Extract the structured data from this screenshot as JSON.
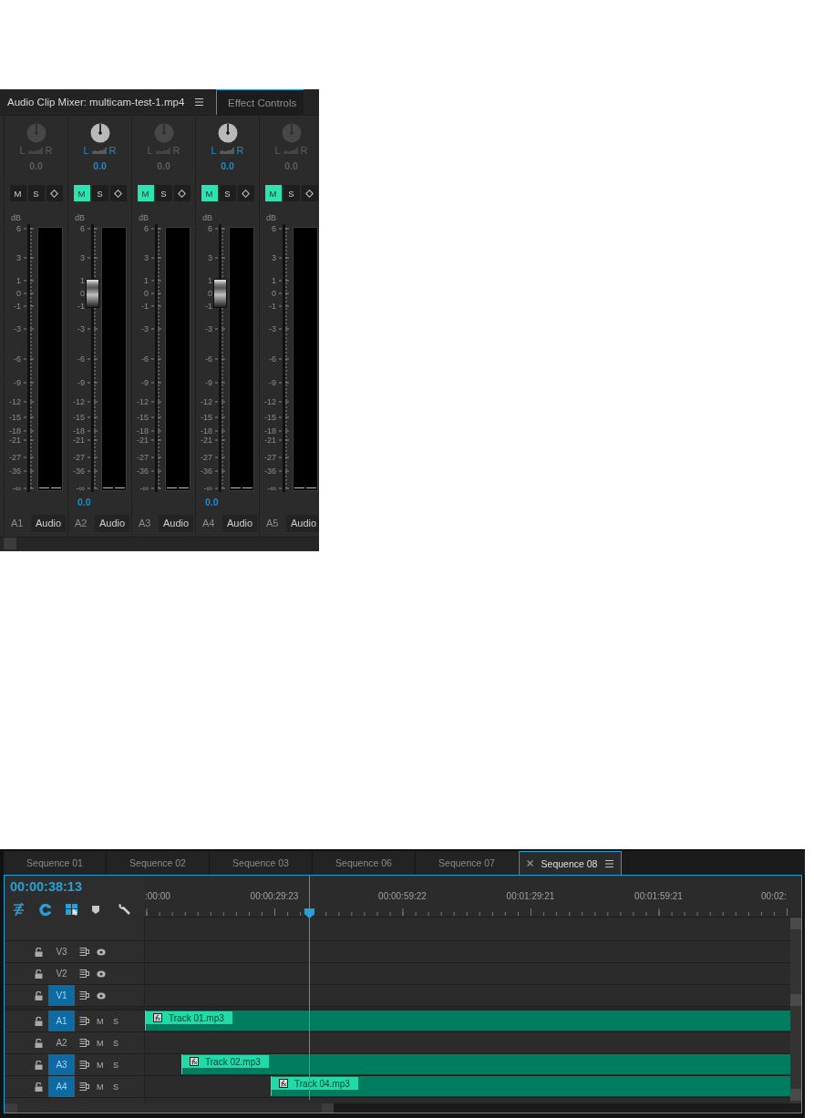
{
  "mixer": {
    "tabs": [
      {
        "label": "Audio Clip Mixer: multicam-test-1.mp4",
        "selected": true,
        "menu": true
      },
      {
        "label": "Effect Controls",
        "selected": false,
        "menu": false
      }
    ],
    "channels": [
      {
        "pan_left": "L",
        "pan_right": "R",
        "pan_value": "0.0",
        "active": false,
        "mute": "M",
        "solo": "S",
        "muted": false,
        "soloed": false,
        "unit": "dB",
        "scale": [
          "6",
          "3",
          "1",
          "0",
          "-1",
          "-3",
          "-6",
          "-9",
          "-12",
          "-15",
          "-18",
          "-21",
          "-27",
          "-36",
          "-∞"
        ],
        "label": "A1",
        "name": "Audio"
      },
      {
        "pan_left": "L",
        "pan_right": "R",
        "pan_value": "0.0",
        "active": true,
        "mute": "M",
        "solo": "S",
        "muted": true,
        "soloed": false,
        "unit": "dB",
        "scale": [
          "6",
          "3",
          "1",
          "0",
          "-1",
          "-3",
          "-6",
          "-9",
          "-12",
          "-15",
          "-18",
          "-21",
          "-27",
          "-36",
          "-∞"
        ],
        "level": 0.75,
        "volume": "0.0",
        "label": "A2",
        "name": "Audio"
      },
      {
        "pan_left": "L",
        "pan_right": "R",
        "pan_value": "0.0",
        "active": false,
        "mute": "M",
        "solo": "S",
        "muted": true,
        "soloed": false,
        "unit": "dB",
        "scale": [
          "6",
          "3",
          "1",
          "0",
          "-1",
          "-3",
          "-6",
          "-9",
          "-12",
          "-15",
          "-18",
          "-21",
          "-27",
          "-36",
          "-∞"
        ],
        "label": "A3",
        "name": "Audio"
      },
      {
        "pan_left": "L",
        "pan_right": "R",
        "pan_value": "0.0",
        "active": true,
        "mute": "M",
        "solo": "S",
        "muted": true,
        "soloed": false,
        "unit": "dB",
        "scale": [
          "6",
          "3",
          "1",
          "0",
          "-1",
          "-3",
          "-6",
          "-9",
          "-12",
          "-15",
          "-18",
          "-21",
          "-27",
          "-36",
          "-∞"
        ],
        "level": 0.75,
        "volume": "0.0",
        "label": "A4",
        "name": "Audio"
      },
      {
        "pan_left": "L",
        "pan_right": "R",
        "pan_value": "0.0",
        "active": false,
        "mute": "M",
        "solo": "S",
        "muted": true,
        "soloed": false,
        "unit": "dB",
        "scale": [
          "6",
          "3",
          "1",
          "0",
          "-1",
          "-3",
          "-6",
          "-9",
          "-12",
          "-15",
          "-18",
          "-21",
          "-27",
          "-36",
          "-∞"
        ],
        "label": "A5",
        "name": "Audio"
      }
    ]
  },
  "timeline": {
    "tabs": [
      {
        "label": "Sequence 01",
        "selected": false
      },
      {
        "label": "Sequence 02",
        "selected": false
      },
      {
        "label": "Sequence 03",
        "selected": false
      },
      {
        "label": "Sequence 06",
        "selected": false
      },
      {
        "label": "Sequence 07",
        "selected": false
      },
      {
        "label": "Sequence 08",
        "selected": true
      }
    ],
    "timecode": "00:00:38:13",
    "ruler": [
      ":00:00",
      "00:00:29:23",
      "00:00:59:22",
      "00:01:29:21",
      "00:01:59:21",
      "00:02:"
    ],
    "tracks": [
      {
        "kind": "video",
        "label": "V3",
        "targeted": false
      },
      {
        "kind": "video",
        "label": "V2",
        "targeted": false
      },
      {
        "kind": "video",
        "label": "V1",
        "targeted": true
      },
      {
        "kind": "audio",
        "label": "A1",
        "targeted": true,
        "mute": "M",
        "solo": "S",
        "clip": {
          "name": "Track 01.mp3"
        }
      },
      {
        "kind": "audio",
        "label": "A2",
        "targeted": false,
        "mute": "M",
        "solo": "S"
      },
      {
        "kind": "audio",
        "label": "A3",
        "targeted": true,
        "mute": "M",
        "solo": "S",
        "clip": {
          "name": "Track 02.mp3"
        }
      },
      {
        "kind": "audio",
        "label": "A4",
        "targeted": true,
        "mute": "M",
        "solo": "S",
        "clip": {
          "name": "Track 04.mp3"
        }
      }
    ]
  }
}
